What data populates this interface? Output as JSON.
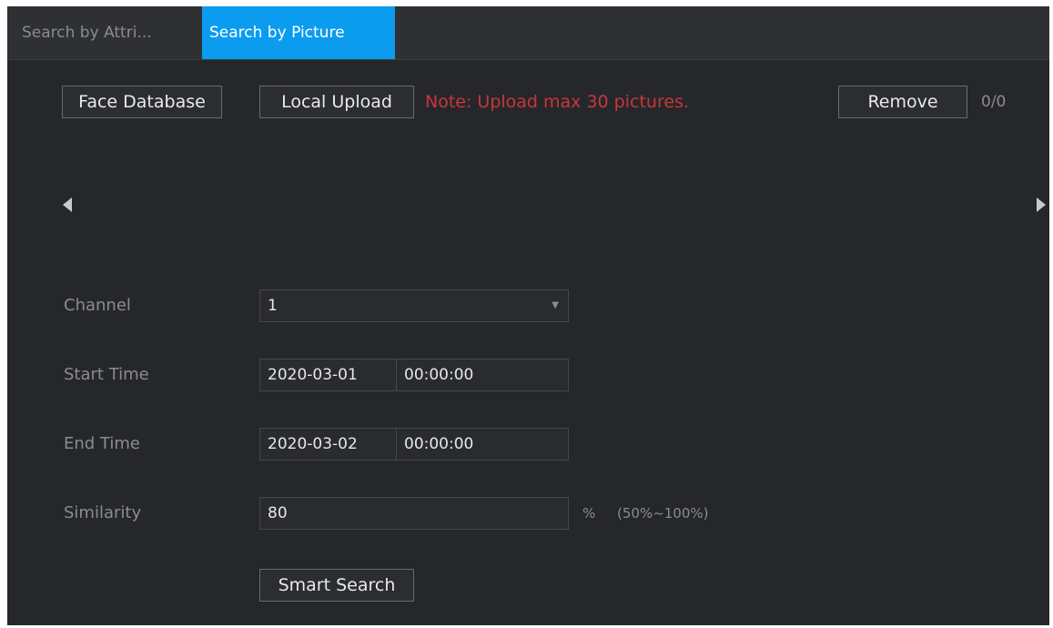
{
  "tabs": [
    {
      "label": "Search by Attri...",
      "active": false
    },
    {
      "label": "Search by Picture",
      "active": true
    }
  ],
  "toolbar": {
    "face_database_label": "Face Database",
    "local_upload_label": "Local Upload",
    "note": "Note: Upload max 30 pictures.",
    "remove_label": "Remove",
    "count": "0/0"
  },
  "carousel": {
    "prev_icon": "triangle-left-icon",
    "next_icon": "triangle-right-icon"
  },
  "form": {
    "channel": {
      "label": "Channel",
      "value": "1"
    },
    "start_time": {
      "label": "Start Time",
      "date": "2020-03-01",
      "time": "00:00:00"
    },
    "end_time": {
      "label": "End Time",
      "date": "2020-03-02",
      "time": "00:00:00"
    },
    "similarity": {
      "label": "Similarity",
      "value": "80",
      "unit": "%",
      "range": "(50%~100%)"
    },
    "smart_search_label": "Smart Search"
  },
  "colors": {
    "accent": "#0b9cf0",
    "note": "#c8363a",
    "background": "#26272b"
  }
}
